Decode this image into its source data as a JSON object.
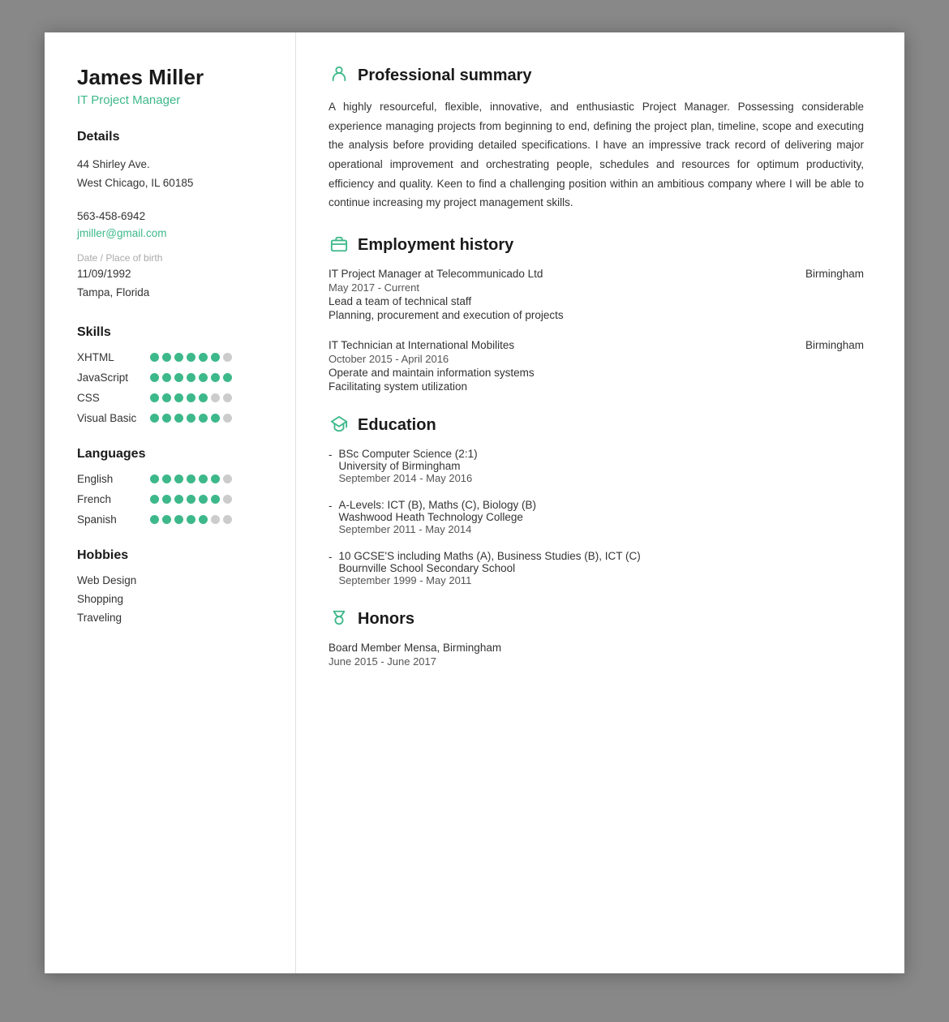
{
  "left": {
    "name": "James Miller",
    "job_title": "IT Project Manager",
    "details_label": "Details",
    "address_line1": "44 Shirley Ave.",
    "address_line2": "West Chicago, IL 60185",
    "phone": "563-458-6942",
    "email": "jmiller@gmail.com",
    "dob_label": "Date / Place of birth",
    "dob": "11/09/1992",
    "dob_place": "Tampa, Florida",
    "skills_label": "Skills",
    "skills": [
      {
        "name": "XHTML",
        "filled": 6,
        "total": 7
      },
      {
        "name": "JavaScript",
        "filled": 7,
        "total": 7
      },
      {
        "name": "CSS",
        "filled": 5,
        "total": 7
      },
      {
        "name": "Visual Basic",
        "filled": 6,
        "total": 7
      }
    ],
    "languages_label": "Languages",
    "languages": [
      {
        "name": "English",
        "filled": 6,
        "total": 7
      },
      {
        "name": "French",
        "filled": 6,
        "total": 7
      },
      {
        "name": "Spanish",
        "filled": 5,
        "total": 7
      }
    ],
    "hobbies_label": "Hobbies",
    "hobbies": [
      "Web Design",
      "Shopping",
      "Traveling"
    ]
  },
  "right": {
    "summary_section": "Professional summary",
    "summary_text": "A highly resourceful, flexible, innovative, and enthusiastic Project Manager. Possessing considerable experience managing projects from beginning to end, defining the project plan, timeline, scope and executing the analysis before providing detailed specifications. I have an impressive track record of delivering major operational improvement and orchestrating people, schedules and resources for optimum productivity, efficiency and quality. Keen to find a challenging position within an ambitious company where I will be able to continue increasing my project management skills.",
    "employment_section": "Employment history",
    "jobs": [
      {
        "title": "IT Project Manager at Telecommunicado Ltd",
        "location": "Birmingham",
        "dates": "May 2017 - Current",
        "details": [
          "Lead a team of technical staff",
          "Planning, procurement and execution of projects"
        ]
      },
      {
        "title": "IT Technician at International Mobilites",
        "location": "Birmingham",
        "dates": "October 2015 - April 2016",
        "details": [
          "Operate and maintain information systems",
          "Facilitating system utilization"
        ]
      }
    ],
    "education_section": "Education",
    "education": [
      {
        "degree": "BSc Computer Science (2:1)",
        "school": "University of Birmingham",
        "dates": "September 2014 - May 2016"
      },
      {
        "degree": "A-Levels: ICT (B), Maths (C), Biology (B)",
        "school": "Washwood Heath Technology College",
        "dates": "September 2011 - May 2014"
      },
      {
        "degree": "10 GCSE'S including Maths (A), Business Studies (B), ICT (C)",
        "school": "Bournville School Secondary School",
        "dates": "September 1999 - May 2011"
      }
    ],
    "honors_section": "Honors",
    "honors": [
      {
        "title": "Board Member Mensa, Birmingham",
        "dates": "June 2015 - June 2017"
      }
    ]
  }
}
